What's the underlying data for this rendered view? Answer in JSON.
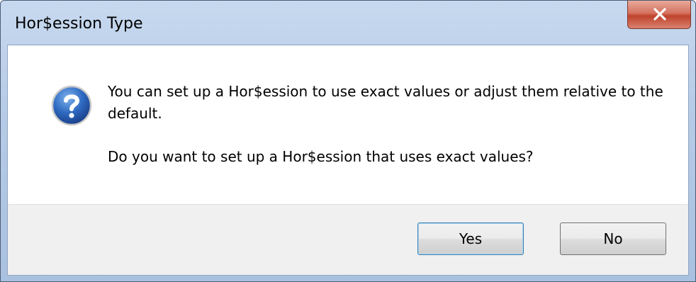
{
  "window": {
    "title": "Hor$ession Type"
  },
  "titlebar": {
    "close_icon": "close-icon"
  },
  "dialog": {
    "icon": "question-icon",
    "message_line1": "You can set up a Hor$ession to use exact values or adjust them relative to the default.",
    "message_line2": "Do you want to set up a Hor$ession that uses exact values?"
  },
  "buttons": {
    "yes_label": "Yes",
    "no_label": "No"
  },
  "colors": {
    "title_bar": "#b6cbe6",
    "close_button": "#c0432c",
    "icon_blue": "#2a5fb0",
    "button_area": "#f0f0f0",
    "default_button_border": "#3c7fb1"
  }
}
